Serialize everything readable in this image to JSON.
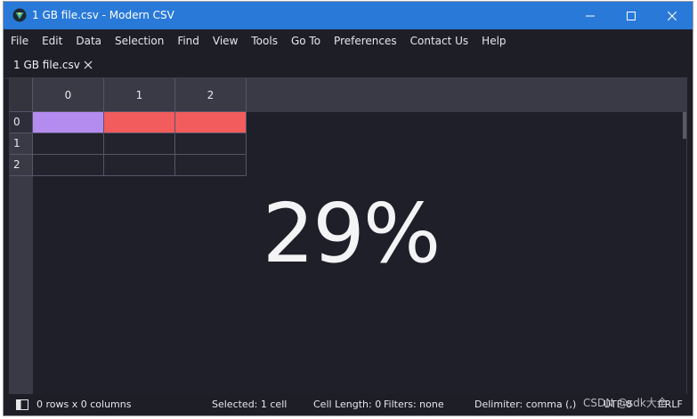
{
  "window": {
    "title": "1 GB file.csv - Modern CSV"
  },
  "menu": {
    "items": [
      "File",
      "Edit",
      "Data",
      "Selection",
      "Find",
      "View",
      "Tools",
      "Go To",
      "Preferences",
      "Contact Us",
      "Help"
    ]
  },
  "tabs": [
    {
      "label": "1 GB file.csv"
    }
  ],
  "grid": {
    "column_headers": [
      "0",
      "1",
      "2"
    ],
    "row_headers": [
      "0",
      "1",
      "2"
    ],
    "row0_cell_colors": [
      "#b48cf0",
      "#f25c5c",
      "#f25c5c"
    ]
  },
  "progress": {
    "text": "29%",
    "value_percent": 29
  },
  "status": {
    "dimensions": "0 rows x 0 columns",
    "selected": "Selected: 1 cell",
    "cell_length": "Cell Length: 0",
    "filters": "Filters: none",
    "delimiter": "Delimiter: comma (,)",
    "encoding": "UTF-8",
    "line_ending": "CRLF"
  },
  "watermark": "CSDN @sdk大全",
  "colors": {
    "titlebar": "#2979d9",
    "background": "#1e1e26",
    "header": "#3a3a46"
  }
}
